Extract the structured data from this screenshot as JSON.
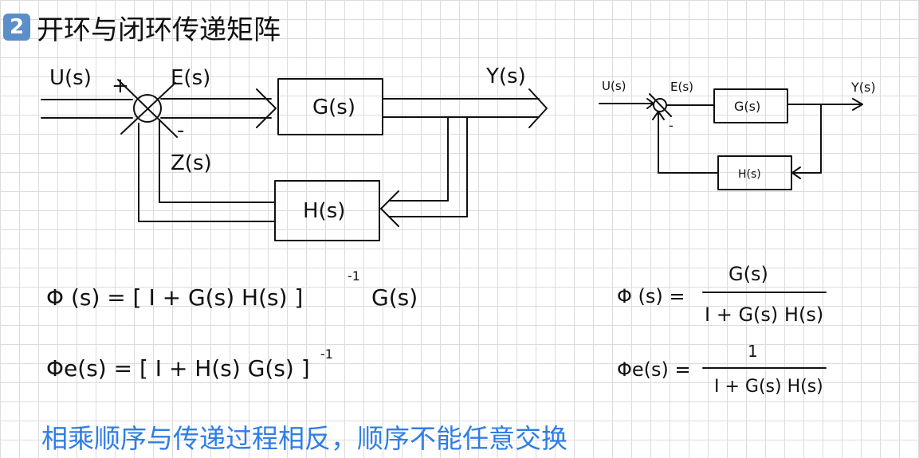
{
  "header": {
    "number": "2",
    "title": "开环与闭环传递矩阵"
  },
  "left_diagram": {
    "input": "U(s)",
    "plus": "+",
    "error": "E(s)",
    "minus": "-",
    "feedback": "Z(s)",
    "forward_block": "G(s)",
    "output": "Y(s)",
    "feedback_block": "H(s)"
  },
  "right_diagram": {
    "input": "U(s)",
    "error": "E(s)",
    "minus": "-",
    "forward_block": "G(s)",
    "output": "Y(s)",
    "feedback_block": "H(s)"
  },
  "formulas": {
    "left_phi": "Φ (s) = [ I + G(s) H(s) ]",
    "left_phi_exp": "-1",
    "left_phi_tail": "G(s)",
    "left_phie": "Φe(s) = [ I + H(s) G(s) ]",
    "left_phie_exp": "-1",
    "right_phi_lhs": "Φ (s) =",
    "right_phi_num": "G(s)",
    "right_phi_den": "I + G(s) H(s)",
    "right_phie_lhs": "Φe(s) =",
    "right_phie_num": "1",
    "right_phie_den": "I + G(s) H(s)"
  },
  "note": "相乘顺序与传递过程相反，顺序不能任意交换",
  "colors": {
    "note": "#2f7ee6",
    "badge": "#5b8fc9",
    "ink": "#111111",
    "grid": "#dcdcdc"
  }
}
